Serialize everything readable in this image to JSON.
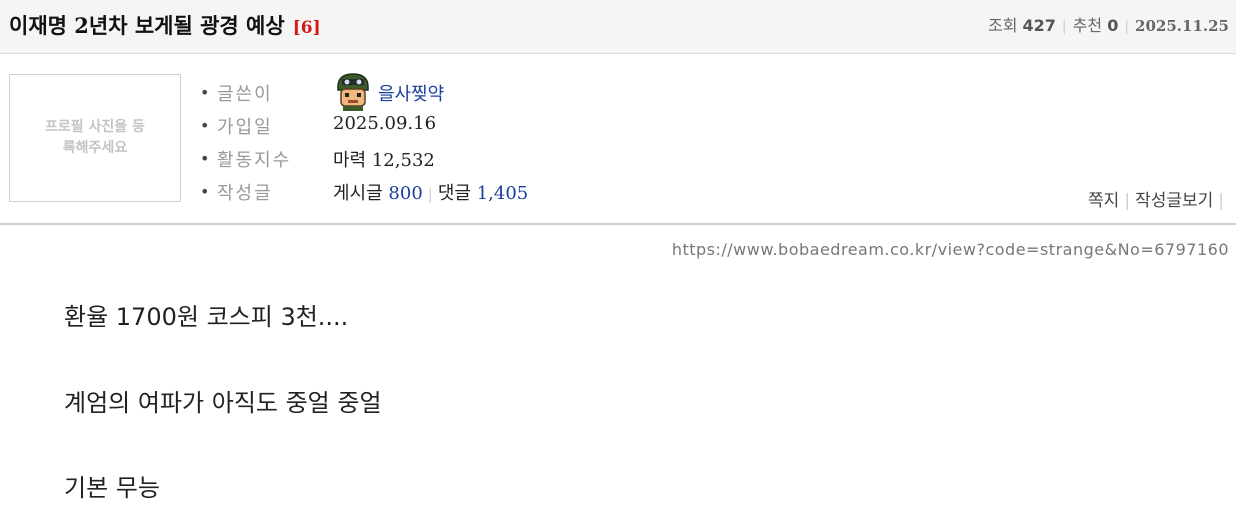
{
  "header": {
    "title": "이재명 2년차 보게될 광경 예상",
    "comment_count": "[6]",
    "views_label": "조회",
    "views": "427",
    "recommend_label": "추천",
    "recommend": "0",
    "date": "2025.11.25"
  },
  "profile": {
    "photo_placeholder": "프로필 사진을 등록해주세요",
    "rows": [
      {
        "label": "글쓴이"
      },
      {
        "label": "가입일",
        "value": "2025.09.16"
      },
      {
        "label": "활동지수",
        "value_label": "마력",
        "value": "12,532"
      },
      {
        "label": "작성글"
      }
    ],
    "nickname": "을사찢약",
    "avatar_icon": "pixel-soldier-avatar-icon",
    "posts_label": "게시글",
    "posts": "800",
    "comments_label": "댓글",
    "comments": "1,405",
    "links": {
      "message": "쪽지",
      "view_posts": "작성글보기"
    }
  },
  "post": {
    "url": "https://www.bobaedream.co.kr/view?code=strange&No=6797160",
    "lines": [
      "환율 1700원 코스피 3천....",
      "계엄의 여파가 아직도 중얼 중얼",
      "기본 무능"
    ]
  },
  "colors": {
    "accent_red": "#d11c1c",
    "link_blue": "#1a3fa0"
  }
}
